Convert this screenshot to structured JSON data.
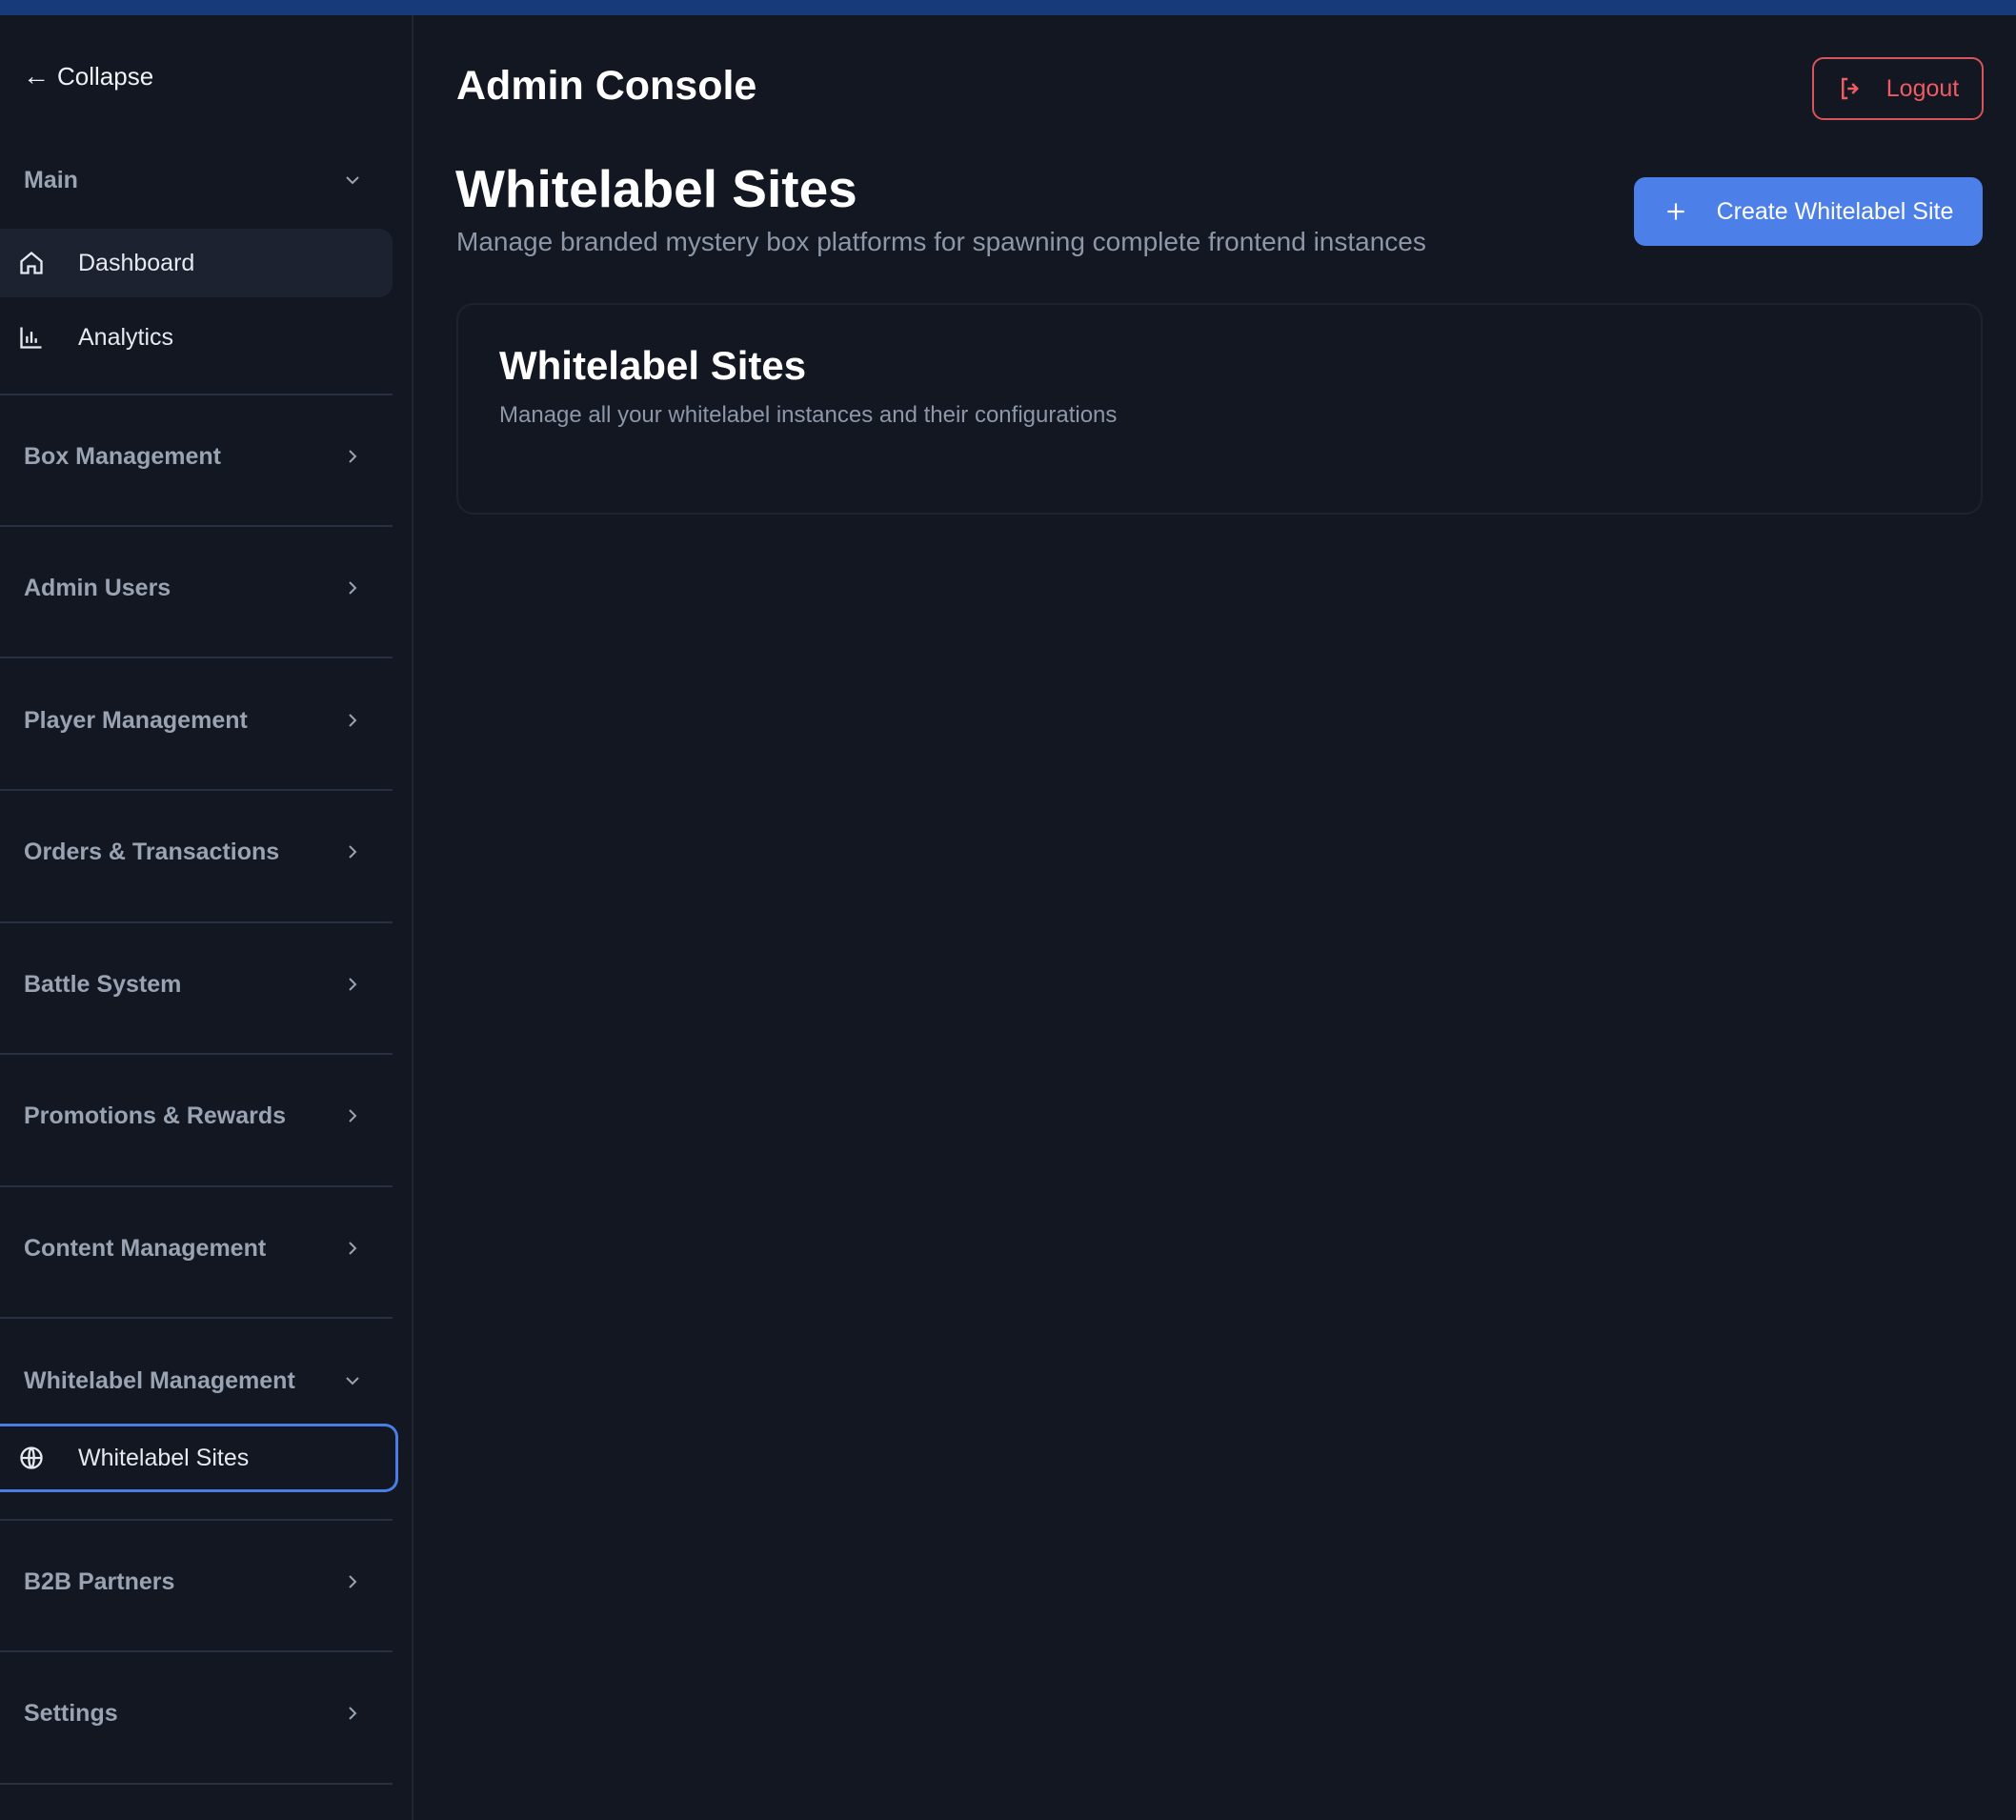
{
  "sidebar": {
    "collapse_label": "Collapse",
    "main_group": "Main",
    "items_main": [
      {
        "label": "Dashboard",
        "icon": "home-icon"
      },
      {
        "label": "Analytics",
        "icon": "bar-chart-icon"
      }
    ],
    "groups": [
      "Box Management",
      "Admin Users",
      "Player Management",
      "Orders & Transactions",
      "Battle System",
      "Promotions & Rewards",
      "Content Management"
    ],
    "whitelabel_group": "Whitelabel Management",
    "whitelabel_item": {
      "label": "Whitelabel Sites",
      "icon": "globe-icon"
    },
    "groups_after": [
      "B2B Partners",
      "Settings"
    ]
  },
  "header": {
    "title": "Admin Console",
    "logout_label": "Logout"
  },
  "page": {
    "title": "Whitelabel Sites",
    "subtitle": "Manage branded mystery box platforms for spawning complete frontend instances",
    "create_label": "Create Whitelabel Site"
  },
  "card": {
    "title": "Whitelabel Sites",
    "subtitle": "Manage all your whitelabel instances and their configurations"
  },
  "colors": {
    "background": "#121722",
    "accent": "#4d7fe8",
    "danger": "#ef5b62",
    "topbar": "#173a7a"
  }
}
